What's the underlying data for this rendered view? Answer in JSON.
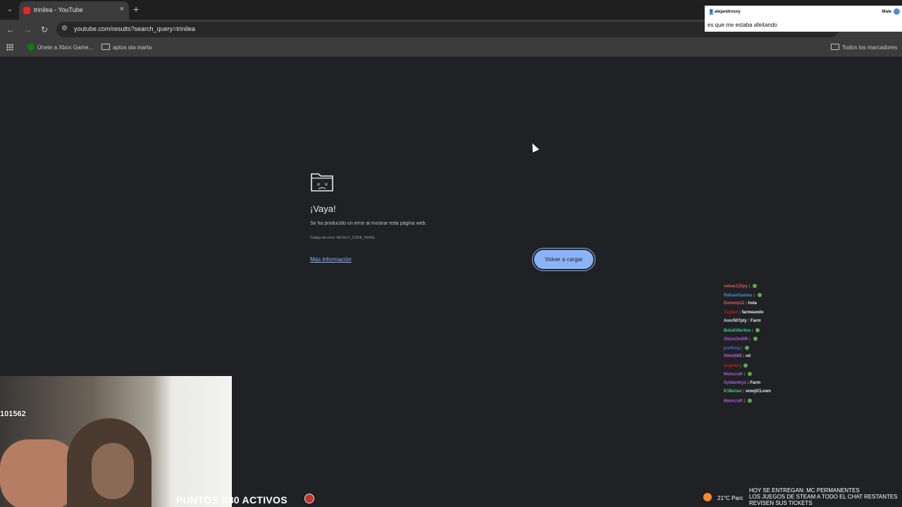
{
  "tab": {
    "title": "trinilea - YouTube",
    "close": "×",
    "new_tab": "+"
  },
  "toolbar": {
    "back": "←",
    "forward": "→",
    "reload": "↻",
    "url": "youtube.com/results?search_query=trinilea"
  },
  "bookmarks": [
    {
      "label": "Únete a Xbox Game..."
    },
    {
      "label": "aptos sta marta"
    }
  ],
  "bookmarks_all": "Todos los marcadores",
  "error": {
    "title": "¡Vaya!",
    "message": "Se ha producido un error al mostrar esta página web.",
    "code": "Código de error: RESULT_CODE_HUNG",
    "learn_more": "Más información",
    "reload": "Volver a cargar"
  },
  "popup": {
    "user": "alejandrosxy",
    "right_label": "Male",
    "message": "es que me estaba afeitando"
  },
  "chat": [
    {
      "user": "sebas123py",
      "text": "",
      "emote": true,
      "color": "#e05a5a"
    },
    {
      "user": "RafsonGames",
      "text": "",
      "emote": true,
      "color": "#4a8ce8"
    },
    {
      "user": "Dunnop12",
      "text": "hola",
      "emote": false,
      "color": "#e05a5a"
    },
    {
      "user": "7Lykan",
      "text": "farmeando",
      "emote": false,
      "color": "#c41e1e"
    },
    {
      "user": "Axor507pty",
      "text": "Farm",
      "emote": false,
      "color": "#e8eaed"
    },
    {
      "user": "BotsKillerttra",
      "text": "",
      "emote": true,
      "color": "#3fcf8e"
    },
    {
      "user": "S0yss3xd06",
      "text": "",
      "emote": true,
      "color": "#b05ad8"
    },
    {
      "user": "justking",
      "text": "",
      "emote": true,
      "color": "#3a6bd1"
    },
    {
      "user": "0btek888",
      "text": "xd",
      "emote": false,
      "color": "#b05ad8"
    },
    {
      "user": "lsopeta",
      "text": "",
      "emote": true,
      "color": "#c41e1e"
    },
    {
      "user": "Meincraft",
      "text": "",
      "emote": true,
      "color": "#b05ad8"
    },
    {
      "user": "Syldanthys",
      "text": "Farm",
      "emote": false,
      "color": "#b05ad8"
    },
    {
      "user": "K1Beiser",
      "text": "emojiCLown",
      "emote": false,
      "color": "#3fcf8e"
    },
    {
      "user": "Meincraft",
      "text": "",
      "emote": true,
      "color": "#b05ad8"
    }
  ],
  "overlay": {
    "counter": "101562",
    "points": "PUNTOS X80 ACTIVOS",
    "weather": "21°C  Parc",
    "ticker": [
      "HOY SE ENTREGAN: MC PERMANENTES",
      "LOS JUEGOS DE STEAM A TODO EL CHAT RESTANTES",
      "REVISEN SUS TICKETS"
    ]
  }
}
